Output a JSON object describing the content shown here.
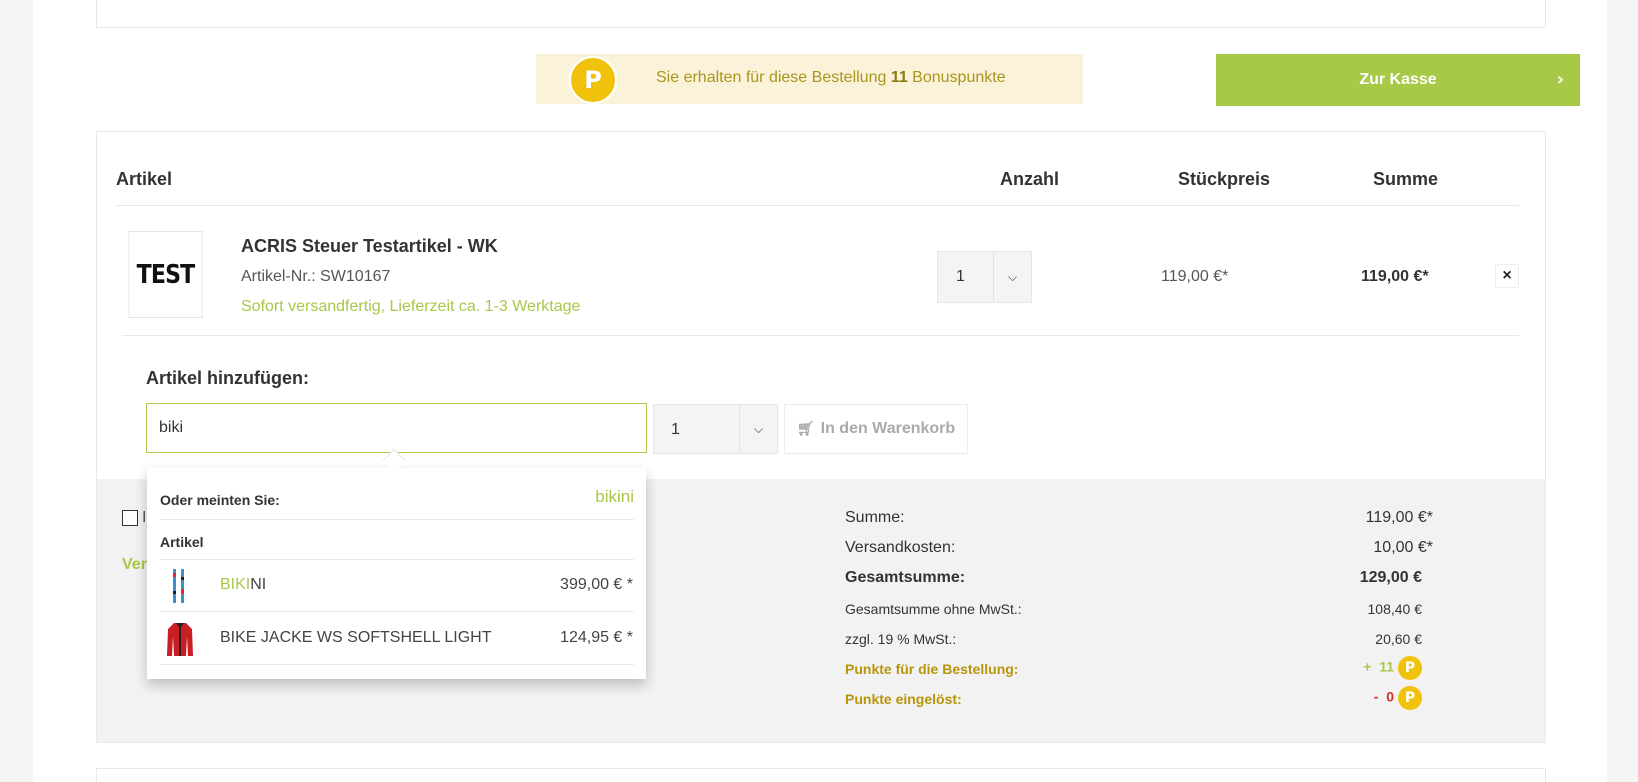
{
  "bonus": {
    "icon": "P",
    "text_before": "Sie erhalten für diese Bestellung ",
    "points": "11",
    "text_after": " Bonuspunkte"
  },
  "checkout": {
    "label": "Zur Kasse",
    "chevron": "›"
  },
  "table": {
    "headers": {
      "article": "Artikel",
      "quantity": "Anzahl",
      "unit_price": "Stückpreis",
      "sum": "Summe"
    }
  },
  "cart_item": {
    "thumb_text": "TEST",
    "name": "ACRIS Steuer Testartikel - WK",
    "article_number": "Artikel-Nr.: SW10167",
    "shipping": "Sofort versandfertig, Lieferzeit ca. 1-3 Werktage",
    "quantity": "1",
    "unit_price": "119,00 €*",
    "sum": "119,00 €*",
    "remove": "×"
  },
  "add_article": {
    "label": "Artikel hinzufügen:",
    "search_value": "biki",
    "quantity": "1",
    "cart_button": "In den Warenkorb"
  },
  "dropdown": {
    "suggest_label": "Oder meinten Sie:",
    "suggestion": "bikini",
    "section_label": "Artikel",
    "results": [
      {
        "name_highlight": "BIKI",
        "name_rest": "NI",
        "price": "399,00 € *"
      },
      {
        "name_highlight": "",
        "name_rest": "BIKE JACKE WS SOFTSHELL LIGHT",
        "price": "124,95 € *"
      }
    ]
  },
  "left_panel": {
    "checkbox_text": "I",
    "link_text": "Ver"
  },
  "totals": {
    "summe_label": "Summe:",
    "summe_value": "119,00 €*",
    "versand_label": "Versandkosten:",
    "versand_value": "10,00 €*",
    "gesamt_label": "Gesamtsumme:",
    "gesamt_value": "129,00 €",
    "netto_label": "Gesamtsumme ohne MwSt.:",
    "netto_value": "108,40 €",
    "mwst_label": "zzgl. 19 % MwSt.:",
    "mwst_value": "20,60 €",
    "punkte_label": "Punkte für die Bestellung:",
    "punkte_sign": "+",
    "punkte_value": "11",
    "eingeloest_label": "Punkte eingelöst:",
    "eingeloest_sign": "-",
    "eingeloest_value": "0",
    "point_icon": "P"
  },
  "colors": {
    "accent": "#a8c847",
    "gold": "#f0c20c",
    "bonus_bg": "#faf3da"
  }
}
